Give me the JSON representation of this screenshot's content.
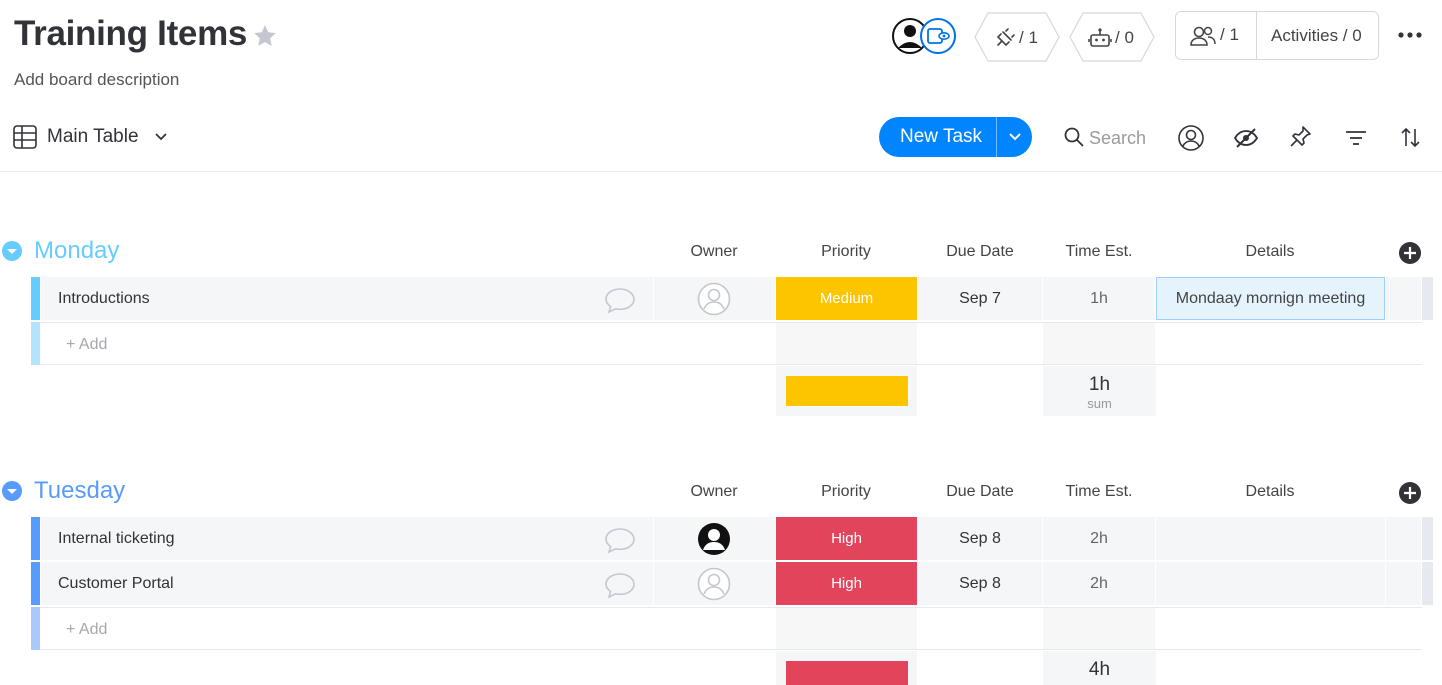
{
  "header": {
    "title": "Training Items",
    "description": "Add board description",
    "integrations_count": "/ 1",
    "automations_count": "/ 0",
    "members_count": "/ 1",
    "activities_label": "Activities / 0"
  },
  "toolbar": {
    "view_label": "Main Table",
    "new_task_label": "New Task",
    "search_label": "Search"
  },
  "columns": {
    "owner": "Owner",
    "priority": "Priority",
    "due_date": "Due Date",
    "time_est": "Time Est.",
    "details": "Details"
  },
  "colors": {
    "monday_group": "#66ccff",
    "tuesday_group": "#579bfc",
    "medium": "#fdc500",
    "high": "#e2445c",
    "primary": "#0085ff"
  },
  "groups": [
    {
      "title": "Monday",
      "add_label": "+ Add",
      "items": [
        {
          "name": "Introductions",
          "priority": "Medium",
          "due": "Sep 7",
          "time": "1h",
          "details": "Mondaay mornign meeting",
          "owner": "empty"
        }
      ],
      "summary_time": "1h",
      "summary_label": "sum"
    },
    {
      "title": "Tuesday",
      "add_label": "+ Add",
      "items": [
        {
          "name": "Internal ticketing",
          "priority": "High",
          "due": "Sep 8",
          "time": "2h",
          "details": "",
          "owner": "assigned"
        },
        {
          "name": "Customer Portal",
          "priority": "High",
          "due": "Sep 8",
          "time": "2h",
          "details": "",
          "owner": "empty"
        }
      ],
      "summary_time": "4h"
    }
  ]
}
